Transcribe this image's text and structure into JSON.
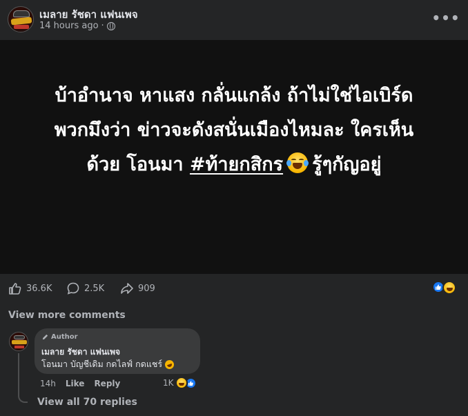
{
  "post": {
    "page_name": "เมลาย รัชดา แฟนเพจ",
    "time": "14 hours ago",
    "separator": "·",
    "privacy_icon": "globe-icon",
    "more_icon": "more-options-icon",
    "more_label": "•••",
    "text_line1": "บ้าอำนาจ หาแสง กลั่นแกล้ง ถ้าไม่ใช่ไอเบิร์ด",
    "text_line2": "พวกมึงว่า ข่าวจะดังสนั่นเมืองไหมละ ใครเห็น",
    "text_line3_prefix": "ด้วย โอนมา ",
    "hashtag": "#ท้ายกสิกร",
    "text_line3_suffix": "รู้ๆกัญอยู่",
    "emoji": "tears-of-joy-emoji"
  },
  "stats": {
    "likes": "36.6K",
    "comments": "2.5K",
    "shares": "909",
    "reactions": [
      "like-icon",
      "haha-icon"
    ]
  },
  "comments_section": {
    "view_more": "View more comments",
    "comment": {
      "badge": "Author",
      "author": "เมลาย รัชดา แฟนเพจ",
      "text": "โอนมา บัญชีเดิม กดไลฟ์ กดแชร์",
      "time": "14h",
      "like": "Like",
      "reply": "Reply",
      "reaction_count": "1K"
    },
    "view_replies": "View all 70 replies"
  },
  "colors": {
    "background": "#242526",
    "image_background": "#111111",
    "bubble": "#3a3b3c",
    "text": "#e4e6eb",
    "secondary_text": "#b0b3b8",
    "like_blue": "#1877f2"
  }
}
